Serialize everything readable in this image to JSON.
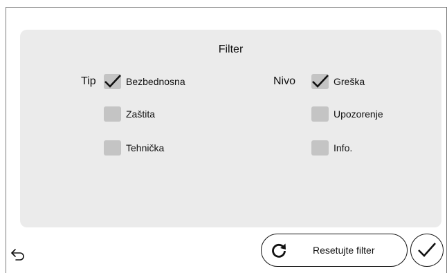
{
  "filter_panel": {
    "title": "Filter",
    "type_group": {
      "label": "Tip",
      "options": [
        {
          "label": "Bezbednosna",
          "checked": true
        },
        {
          "label": "Zaštita",
          "checked": false
        },
        {
          "label": "Tehnička",
          "checked": false
        }
      ]
    },
    "level_group": {
      "label": "Nivo",
      "options": [
        {
          "label": "Greška",
          "checked": true
        },
        {
          "label": "Upozorenje",
          "checked": false
        },
        {
          "label": "Info.",
          "checked": false
        }
      ]
    }
  },
  "footer": {
    "back_icon": "undo-arrow-icon",
    "reset_icon": "refresh-icon",
    "reset_label": "Resetujte filter",
    "confirm_icon": "checkmark-icon"
  },
  "colors": {
    "panel_bg": "#ebebeb",
    "checkbox_bg": "#c4c4c4",
    "frame_line": "#7a7a7a",
    "text": "#111111"
  }
}
